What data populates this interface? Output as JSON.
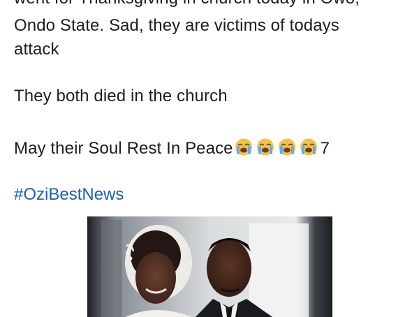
{
  "post": {
    "line_cut": "went for Thanksgiving in church today in Owo,",
    "line_2": "Ondo State. Sad, they are victims of todays",
    "line_3": "attack",
    "line_4": "They both died in the church",
    "line_5_text": "May their Soul Rest In Peace",
    "line_5_suffix": "7",
    "emoji": [
      "loudly-crying-face",
      "loudly-crying-face",
      "loudly-crying-face",
      "loudly-crying-face"
    ],
    "hashtag": "#OziBestNews"
  },
  "colors": {
    "text": "#1d1d1d",
    "hashtag": "#1b5fb8",
    "emoji": "#f6c244"
  }
}
